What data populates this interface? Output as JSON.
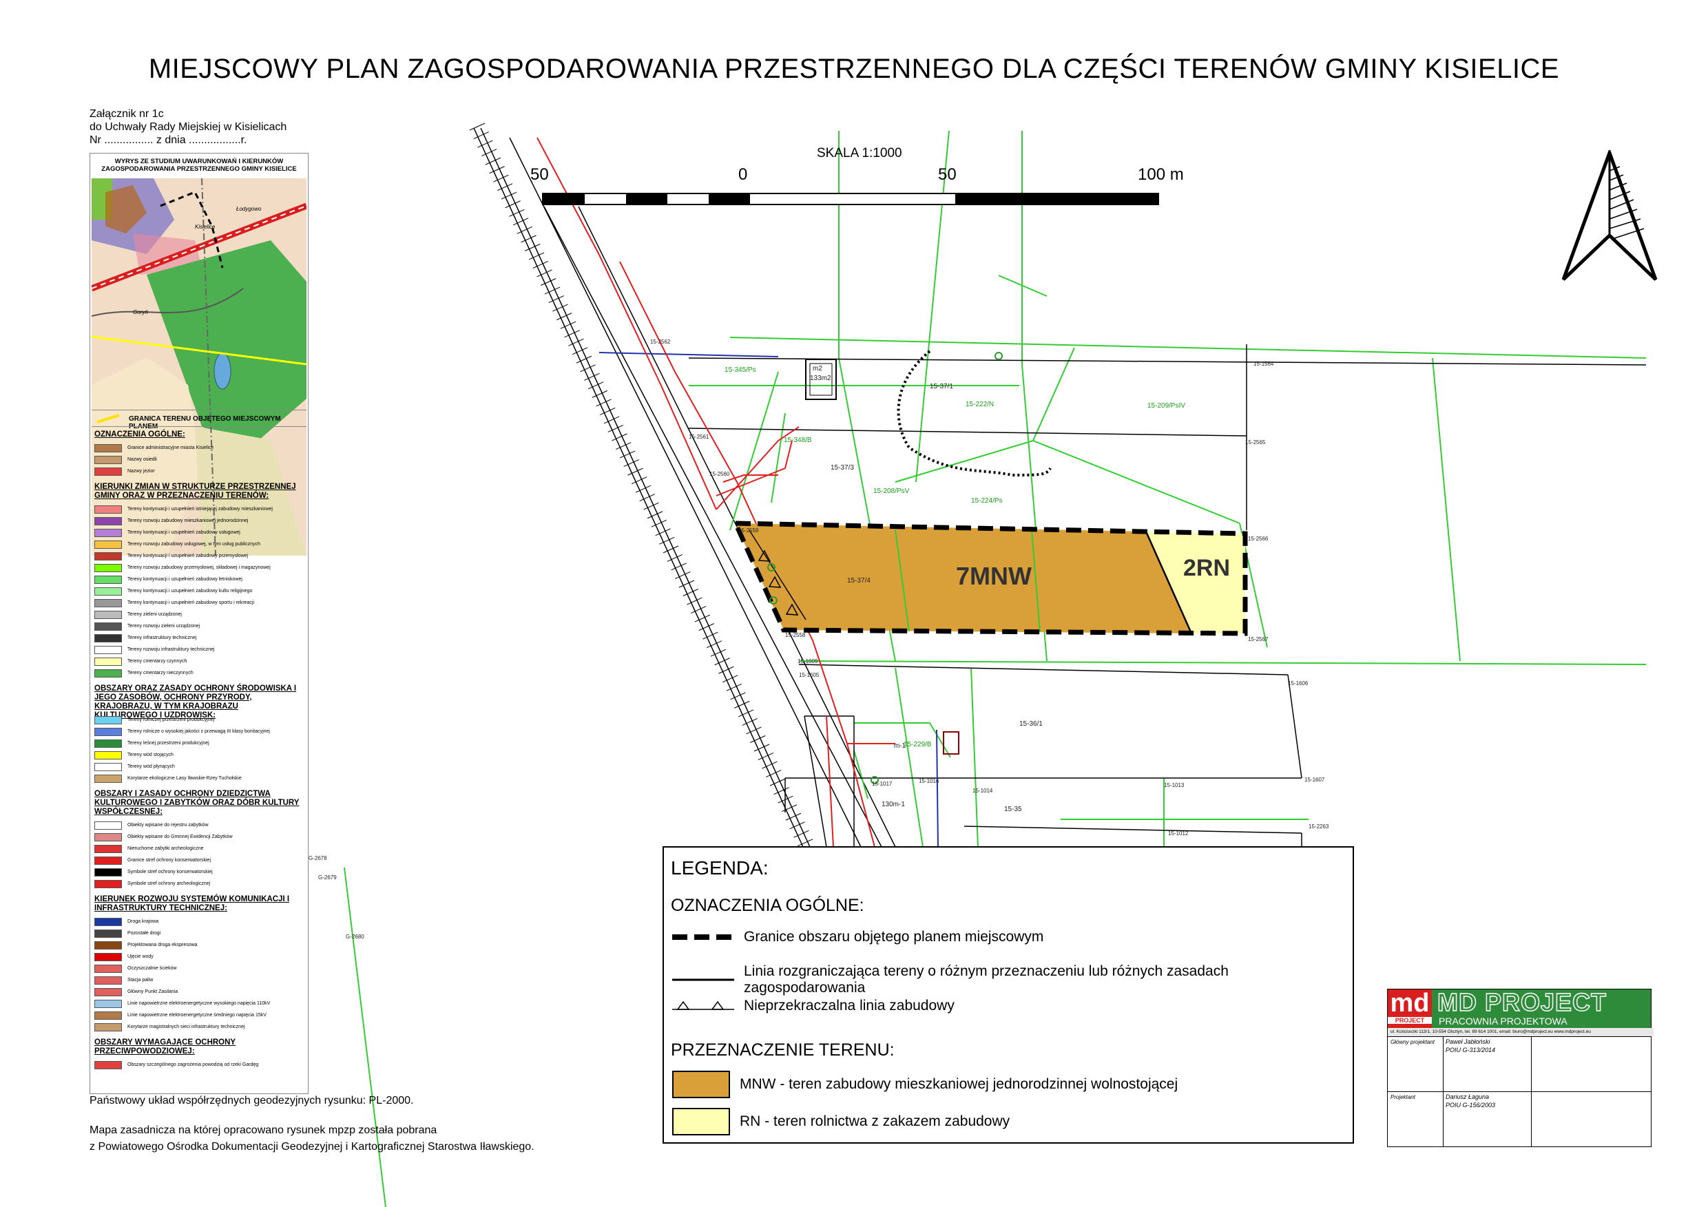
{
  "header": {
    "title": "MIEJSCOWY PLAN ZAGOSPODAROWANIA PRZESTRZENNEGO DLA CZĘŚCI TERENÓW GMINY KISIELICE",
    "annex_line1": "Załącznik nr 1c",
    "annex_line2": "do Uchwały Rady Miejskiej w Kisielicach",
    "annex_line3": "Nr ................ z dnia .................r."
  },
  "scale": {
    "label": "SKALA 1:1000",
    "ticks": [
      "50",
      "0",
      "50",
      "100 m"
    ]
  },
  "study": {
    "title_line1": "WYRYS ZE STUDIUM UWARUNKOWAŃ  I KIERUNKÓW",
    "title_line2": "ZAGOSPODAROWANIA PRZESTRZENNEGO GMINY KISIELICE",
    "map_labels": [
      "Kisielice",
      "Goryń",
      "Łodygowo"
    ],
    "boundary_label": "GRANICA TERENU OBJĘTEGO MIEJSCOWYM PLANEM",
    "sections": [
      {
        "heading": "OZNACZENIA OGÓLNE:",
        "items": [
          "Granice administracyjne miasta Kisielice",
          "Nazwy osiedli",
          "Nazwy jezior"
        ]
      },
      {
        "heading": "KIERUNKI ZMIAN W STRUKTURZE PRZESTRZENNEJ GMINY ORAZ W PRZEZNACZENIU TERENÓW:",
        "items": [
          "Tereny kontynuacji i uzupełnień istniejącej zabudowy mieszkaniowej",
          "Tereny rozwoju zabudowy mieszkaniowej jednorodzinnej",
          "Tereny kontynuacji i uzupełnień zabudowy usługowej",
          "Tereny rozwoju zabudowy usługowej, w tym usług publicznych",
          "Tereny kontynuacji i uzupełnień zabudowy przemysłowej",
          "Tereny rozwoju zabudowy przemysłowej, składowej i magazynowej",
          "Tereny kontynuacji i uzupełnień zabudowy letniskowej",
          "Tereny kontynuacji i uzupełnień zabudowy kultu religijnego",
          "Tereny kontynuacji i uzupełnień zabudowy sportu i rekreacji",
          "Tereny zieleni urządzonej",
          "Tereny rozwoju zieleni urządzonej",
          "Tereny infrastruktury technicznej",
          "Tereny rozwoju infrastruktury technicznej",
          "Tereny cmentarzy czynnych",
          "Tereny cmentarzy nieczynnych"
        ]
      },
      {
        "heading": "OBSZARY ORAZ ZASADY OCHRONY ŚRODOWISKA I JEGO ZASOBÓW, OCHRONY PRZYRODY, KRAJOBRAZU, W TYM KRAJOBRAZU KULTUROWEGO I UZDROWISK:",
        "items": [
          "Tereny rolniczej przestrzeni produkcyjnej",
          "Tereny rolnicze o wysokiej jakości z przewagą III klasy bonitacyjnej",
          "Tereny leśnej przestrzeni produkcyjnej",
          "Tereny wód stojących",
          "Tereny wód płynących",
          "Korytarze ekologiczne Lasy Iławskie-Rzey Tuchołskie"
        ]
      },
      {
        "heading": "OBSZARY I ZASADY OCHRONY DZIEDZICTWA KULTUROWEGO I ZABYTKÓW ORAZ DÓBR KULTURY WSPÓŁCZESNEJ:",
        "items": [
          "Obiekty wpisane do rejestru zabytków",
          "Obiekty wpisane do Gminnej Ewidencji Zabytków",
          "Nieruchome zabytki archeologiczne",
          "Granice stref ochrony konserwatorskiej",
          "Symbole stref ochrony konserwatorskiej",
          "Symbole stref ochrony archeologicznej"
        ]
      },
      {
        "heading": "KIERUNEK ROZWOJU SYSTEMÓW KOMUNIKACJI I INFRASTRUKTURY TECHNICZNEJ:",
        "items": [
          "Droga krajowa",
          "Pozostałe drogi",
          "Projektowana droga ekspresowa",
          "Ujęcie wody",
          "Oczyszczalnie ścieków",
          "Stacja paliw",
          "Główny Punkt Zasilania",
          "Linie napowietrzne elektroenergetyczne wysokiego napięcia 110kV",
          "Linie napowietrzne elektroenergetyczne średniego napięcia 15kV",
          "Korytarze magistralnych sieci infrastruktury technicznej"
        ]
      },
      {
        "heading": "OBSZARY WYMAGAJĄCE OCHRONY PRZECIWPOWODZIOWEJ:",
        "items": [
          "Obszary szczególnego zagrożenia powodzią od rzeki Gardęg"
        ]
      }
    ]
  },
  "plan": {
    "zones": [
      {
        "symbol": "7MNW",
        "color": "#d9a03a"
      },
      {
        "symbol": "2RN",
        "color": "#ffffb4"
      }
    ],
    "parcels": [
      "15-37/1",
      "15-37/3",
      "15-37/4",
      "m2",
      "133m2",
      "15-36/1",
      "15-35",
      "m-1",
      "130m-1"
    ],
    "land_classes": [
      "15-345/Ps",
      "15-222/N",
      "15-209/PsIV",
      "15-348/B",
      "15-208/PsV",
      "15-224/Ps",
      "15-229/B"
    ],
    "points": [
      "15-2562",
      "15-2561",
      "15-2560",
      "15-2559",
      "15-2558",
      "15-2565",
      "15-2566",
      "15-2567",
      "15-1009",
      "15-1605",
      "15-1606",
      "15-1607",
      "15-1012",
      "15-1013",
      "15-1014",
      "15-2263",
      "15-1564",
      "15-1017",
      "15-1016",
      "G-2678",
      "G-2679",
      "G-2680"
    ]
  },
  "legend": {
    "title": "LEGENDA:",
    "general_heading": "OZNACZENIA OGÓLNE:",
    "general_items": [
      "Granice obszaru objętego planem miejscowym",
      "Linia rozgraniczająca tereny o różnym przeznaczeniu lub różnych zasadach zagospodarowania",
      "Nieprzekraczalna linia zabudowy"
    ],
    "purpose_heading": "PRZEZNACZENIE TERENU:",
    "purpose_items": [
      {
        "label": "MNW - teren zabudowy mieszkaniowej jednorodzinnej wolnostojącej",
        "color": "#d9a03a"
      },
      {
        "label": "RN - teren rolnictwa z zakazem zabudowy",
        "color": "#ffffb4"
      }
    ]
  },
  "footer": {
    "coord_system": "Państwowy układ współrzędnych geodezyjnych rysunku: PL-2000.",
    "source_line1": "Mapa zasadnicza na której opracowano rysunek mpzp została pobrana",
    "source_line2": "z Powiatowego Ośrodka Dokumentacji Geodezyjnej i Kartograficznej Starostwa Iławskiego."
  },
  "stamp": {
    "logo_md": "md",
    "logo_project": "PROJECT",
    "company": "MD PROJECT",
    "subtitle": "PRACOWNIA PROJEKTOWA",
    "address": "ul. Kościuszki 113/1,  10-554 Olsztyn,  tel. 89 614 1001,  email: biuro@mdproject.eu  www.mdproject.eu",
    "role1": "Główny projektant",
    "name1": "Paweł Jabłoński",
    "license1": "POIU G-313/2014",
    "role2": "Projektant",
    "name2": "Dariusz Łaguna",
    "license2": "POIU G-156/2003"
  },
  "colors": {
    "mnw": "#d9a03a",
    "rn": "#ffffb4",
    "green_line": "#33cc33",
    "red_line": "#e02020",
    "brand_green": "#2e8b3a",
    "brand_red": "#d81e1e"
  },
  "north_arrow": "north-arrow-icon"
}
